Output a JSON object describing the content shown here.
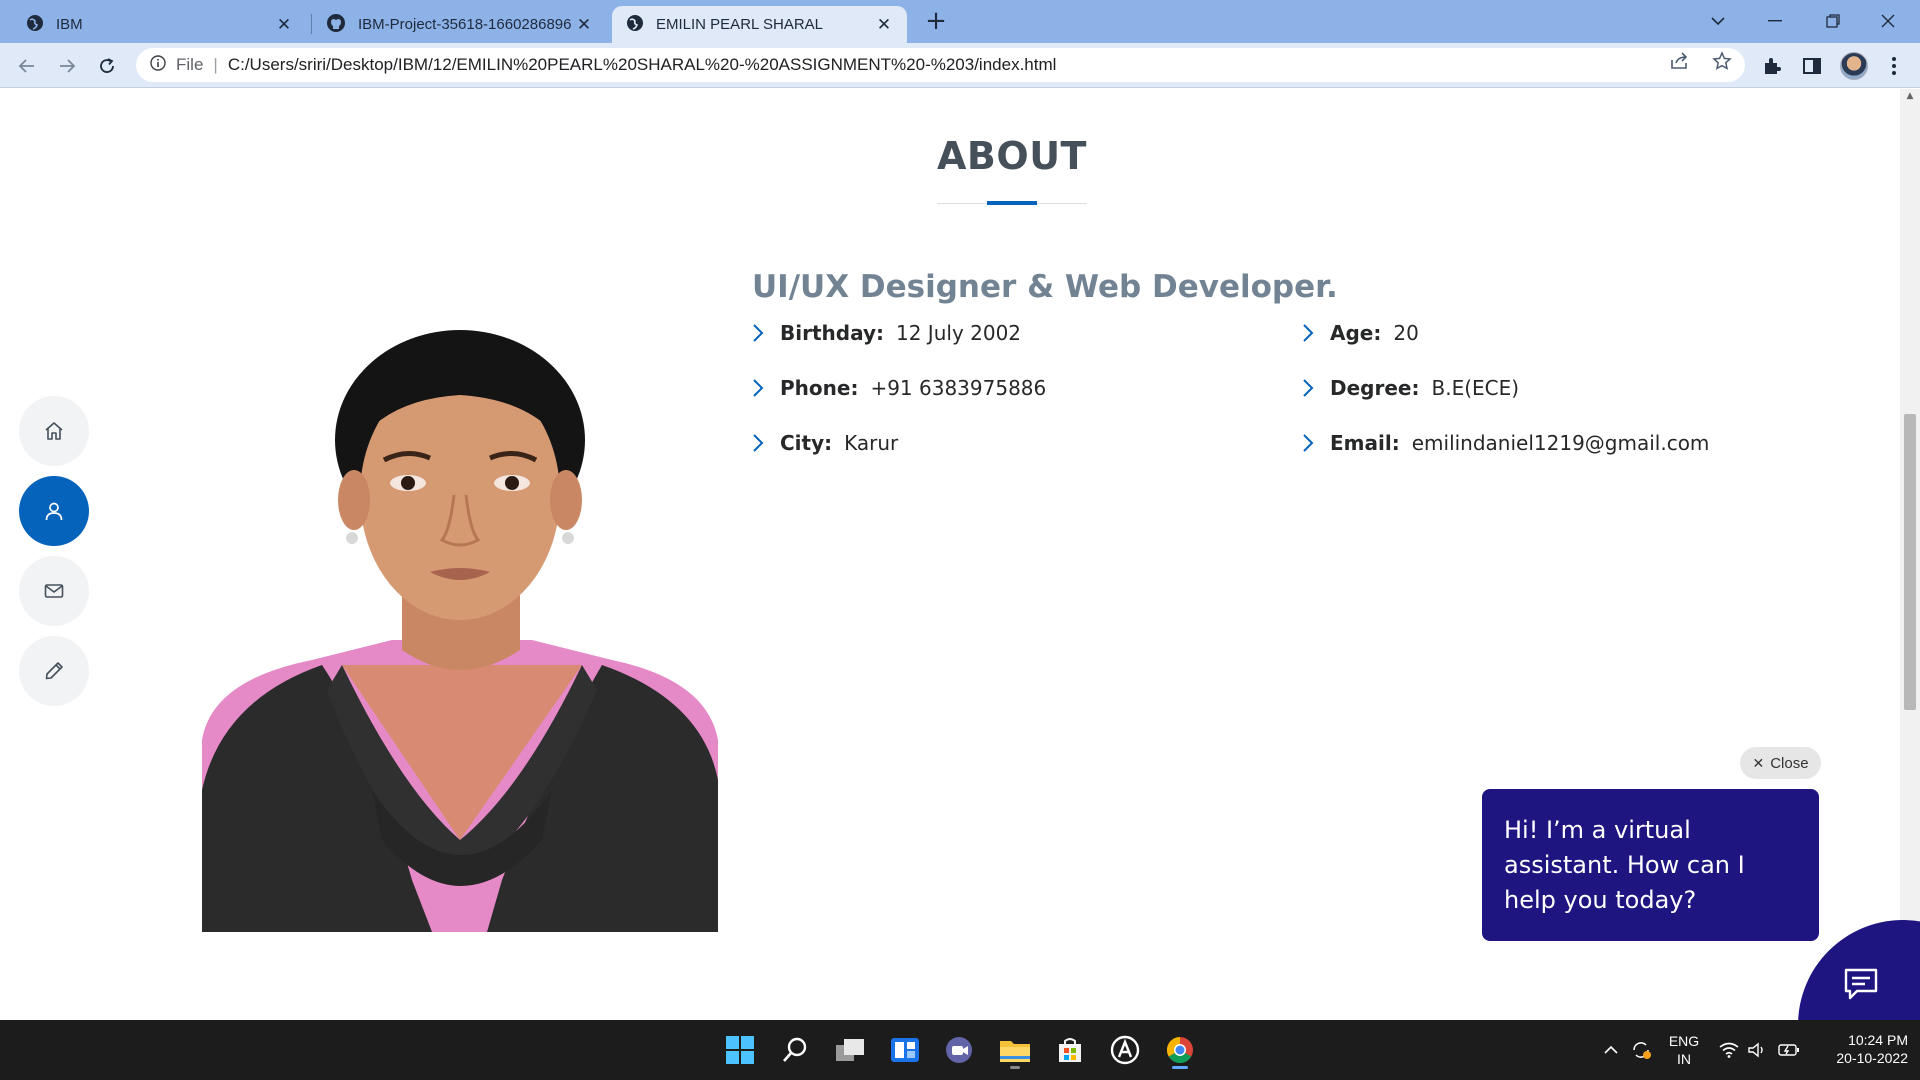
{
  "browser": {
    "tabs": [
      {
        "title": "IBM",
        "active": false
      },
      {
        "title": "IBM-Project-35618-1660286896",
        "active": false
      },
      {
        "title": "EMILIN PEARL SHARAL",
        "active": true
      }
    ],
    "file_label": "File",
    "url": "C:/Users/sriri/Desktop/IBM/12/EMILIN%20PEARL%20SHARAL%20-%20ASSIGNMENT%20-%203/index.html"
  },
  "about": {
    "section_title": "ABOUT",
    "role_title": "UI/UX Designer & Web Developer.",
    "info": [
      {
        "label": "Birthday:",
        "value": "12 July 2002"
      },
      {
        "label": "Phone:",
        "value": "+91 6383975886"
      },
      {
        "label": "City:",
        "value": "Karur"
      },
      {
        "label": "Age:",
        "value": "20"
      },
      {
        "label": "Degree:",
        "value": "B.E(ECE)"
      },
      {
        "label": "Email:",
        "value": "emilindaniel1219@gmail.com"
      }
    ]
  },
  "sidenav": {
    "items": [
      {
        "icon": "home-icon",
        "active": false
      },
      {
        "icon": "user-icon",
        "active": true
      },
      {
        "icon": "mail-icon",
        "active": false
      },
      {
        "icon": "pencil-icon",
        "active": false
      }
    ]
  },
  "chat": {
    "close_label": "Close",
    "message": "Hi! I’m a virtual assistant. How can I help you today?"
  },
  "taskbar": {
    "lang_line1": "ENG",
    "lang_line2": "IN",
    "time": "10:24 PM",
    "date": "20-10-2022"
  },
  "colors": {
    "accent": "#0563bb",
    "chat": "#1f1580",
    "tabbar": "#8db2e8"
  }
}
